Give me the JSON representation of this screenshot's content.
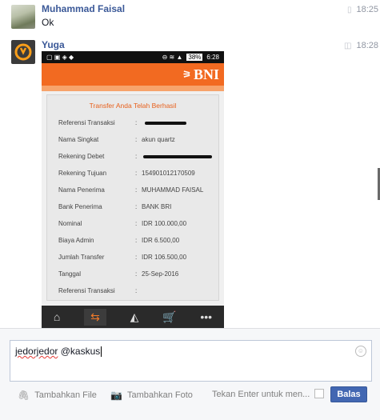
{
  "messages": [
    {
      "sender": "Muhammad Faisal",
      "text": "Ok",
      "time": "18:25"
    },
    {
      "sender": "Yuga",
      "time": "18:28"
    }
  ],
  "screenshot": {
    "status_battery": "38%",
    "status_time": "6:28",
    "bank_logo": "BNI",
    "title": "Transfer Anda Telah Berhasil",
    "rows": [
      {
        "label": "Referensi Transaksi",
        "value": ""
      },
      {
        "label": "Nama Singkat",
        "value": "akun quartz"
      },
      {
        "label": "Rekening Debet",
        "value": ""
      },
      {
        "label": "Rekening Tujuan",
        "value": "154901012170509"
      },
      {
        "label": "Nama Penerima",
        "value": "MUHAMMAD FAISAL"
      },
      {
        "label": "Bank Penerima",
        "value": "BANK BRI"
      },
      {
        "label": "Nominal",
        "value": "IDR 100.000,00"
      },
      {
        "label": "Biaya Admin",
        "value": "IDR 6.500,00"
      },
      {
        "label": "Jumlah Transfer",
        "value": "IDR 106.500,00"
      },
      {
        "label": "Tanggal",
        "value": "25-Sep-2016"
      },
      {
        "label": "Referensi Transaksi",
        "value": ""
      }
    ]
  },
  "composer": {
    "input_word1": "jedorjedor",
    "input_word2": "@kaskus",
    "add_file": "Tambahkan File",
    "add_photo": "Tambahkan Foto",
    "enter_hint": "Tekan Enter untuk men...",
    "send_label": "Balas"
  },
  "colors": {
    "link_blue": "#3b5998",
    "button_blue": "#4267b2",
    "bni_orange": "#f26a21"
  }
}
